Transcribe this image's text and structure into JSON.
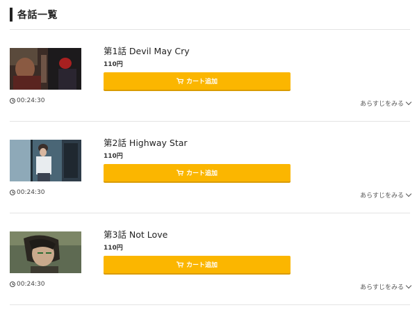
{
  "section": {
    "title": "各話一覧"
  },
  "episodes": [
    {
      "title": "第1話 Devil May Cry",
      "price": "110円",
      "cart_label": "カート追加",
      "duration": "00:24:30",
      "synopsis_label": "あらすじをみる"
    },
    {
      "title": "第2話 Highway Star",
      "price": "110円",
      "cart_label": "カート追加",
      "duration": "00:24:30",
      "synopsis_label": "あらすじをみる"
    },
    {
      "title": "第3話 Not Love",
      "price": "110円",
      "cart_label": "カート追加",
      "duration": "00:24:30",
      "synopsis_label": "あらすじをみる"
    }
  ],
  "colors": {
    "accent": "#fbb600",
    "divider": "#e3e3e3"
  },
  "icons": {
    "cart": "cart-icon",
    "clock": "clock-icon",
    "chevron": "chevron-down-icon"
  }
}
